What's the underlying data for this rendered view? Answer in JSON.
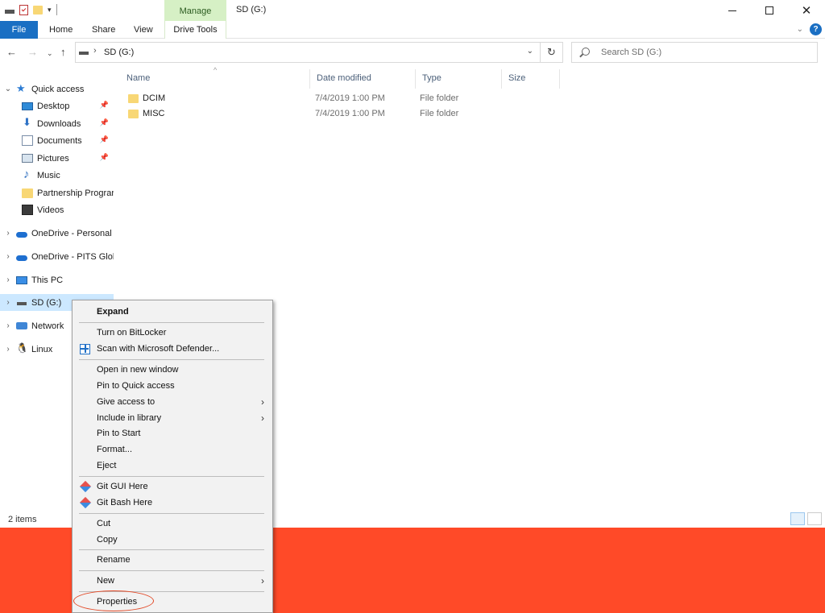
{
  "window": {
    "title": "SD (G:)",
    "contextual_tab": "Manage"
  },
  "ribbon": {
    "tabs": [
      "File",
      "Home",
      "Share",
      "View",
      "Drive Tools"
    ]
  },
  "address": {
    "path": "SD (G:)"
  },
  "search": {
    "placeholder": "Search SD (G:)"
  },
  "nav": {
    "quick_access": "Quick access",
    "items": [
      {
        "label": "Desktop",
        "icon": "desktop-icon",
        "pinned": true
      },
      {
        "label": "Downloads",
        "icon": "downloads-icon",
        "pinned": true
      },
      {
        "label": "Documents",
        "icon": "documents-icon",
        "pinned": true
      },
      {
        "label": "Pictures",
        "icon": "pictures-icon",
        "pinned": true
      },
      {
        "label": "Music",
        "icon": "music-icon",
        "pinned": false
      },
      {
        "label": "Partnership Prograr",
        "icon": "folder-icon",
        "pinned": false
      },
      {
        "label": "Videos",
        "icon": "videos-icon",
        "pinned": false
      }
    ],
    "roots": [
      {
        "label": "OneDrive - Personal",
        "icon": "onedrive-icon"
      },
      {
        "label": "OneDrive - PITS Glob",
        "icon": "onedrive-icon"
      },
      {
        "label": "This PC",
        "icon": "this-pc-icon"
      },
      {
        "label": "SD (G:)",
        "icon": "drive-icon"
      },
      {
        "label": "Network",
        "icon": "network-icon"
      },
      {
        "label": "Linux",
        "icon": "linux-icon"
      }
    ]
  },
  "columns": {
    "name": "Name",
    "date": "Date modified",
    "type": "Type",
    "size": "Size"
  },
  "files": [
    {
      "name": "DCIM",
      "date": "7/4/2019 1:00 PM",
      "type": "File folder"
    },
    {
      "name": "MISC",
      "date": "7/4/2019 1:00 PM",
      "type": "File folder"
    }
  ],
  "status": {
    "count": "2 items"
  },
  "context_menu": {
    "expand": "Expand",
    "bitlocker": "Turn on BitLocker",
    "defender": "Scan with Microsoft Defender...",
    "open_new": "Open in new window",
    "pin_quick": "Pin to Quick access",
    "give_access": "Give access to",
    "include_lib": "Include in library",
    "pin_start": "Pin to Start",
    "format": "Format...",
    "eject": "Eject",
    "git_gui": "Git GUI Here",
    "git_bash": "Git Bash Here",
    "cut": "Cut",
    "copy": "Copy",
    "rename": "Rename",
    "new": "New",
    "properties": "Properties"
  },
  "colors": {
    "accent": "#1a6fc3",
    "manage_tab": "#d6f0c5",
    "highlight_band": "#ff4a28",
    "selection": "#cce8ff"
  }
}
